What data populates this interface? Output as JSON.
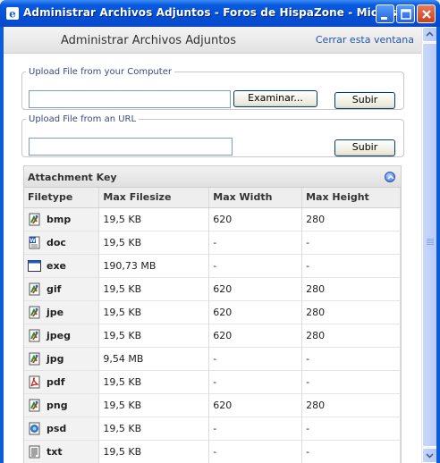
{
  "window": {
    "title": "Administrar Archivos Adjuntos - Foros de HispaZone - Micros..."
  },
  "header": {
    "title": "Administrar Archivos Adjuntos",
    "close_link": "Cerrar esta ventana"
  },
  "upload_computer": {
    "legend": "Upload File from your Computer",
    "value": "",
    "browse_label": "Examinar...",
    "submit_label": "Subir"
  },
  "upload_url": {
    "legend": "Upload File from an URL",
    "value": "",
    "submit_label": "Subir"
  },
  "attachment_key": {
    "title": "Attachment Key",
    "columns": [
      "Filetype",
      "Max Filesize",
      "Max Width",
      "Max Height"
    ],
    "rows": [
      {
        "type": "bmp",
        "icon": "image-file-icon",
        "size": "19,5 KB",
        "width": "620",
        "height": "280"
      },
      {
        "type": "doc",
        "icon": "word-document-icon",
        "size": "19,5 KB",
        "width": "-",
        "height": "-"
      },
      {
        "type": "exe",
        "icon": "application-window-icon",
        "size": "190,73 MB",
        "width": "-",
        "height": "-"
      },
      {
        "type": "gif",
        "icon": "image-file-icon",
        "size": "19,5 KB",
        "width": "620",
        "height": "280"
      },
      {
        "type": "jpe",
        "icon": "image-file-icon",
        "size": "19,5 KB",
        "width": "620",
        "height": "280"
      },
      {
        "type": "jpeg",
        "icon": "image-file-icon",
        "size": "19,5 KB",
        "width": "620",
        "height": "280"
      },
      {
        "type": "jpg",
        "icon": "image-file-icon",
        "size": "9,54 MB",
        "width": "-",
        "height": "-"
      },
      {
        "type": "pdf",
        "icon": "pdf-file-icon",
        "size": "19,5 KB",
        "width": "-",
        "height": "-"
      },
      {
        "type": "png",
        "icon": "image-file-icon",
        "size": "19,5 KB",
        "width": "620",
        "height": "280"
      },
      {
        "type": "psd",
        "icon": "photoshop-file-icon",
        "size": "19,5 KB",
        "width": "-",
        "height": "-"
      },
      {
        "type": "txt",
        "icon": "text-file-icon",
        "size": "19,5 KB",
        "width": "-",
        "height": "-"
      }
    ]
  },
  "colors": {
    "titlebar": "#0a5ae0",
    "link": "#2255aa",
    "legend": "#3a4a80"
  }
}
